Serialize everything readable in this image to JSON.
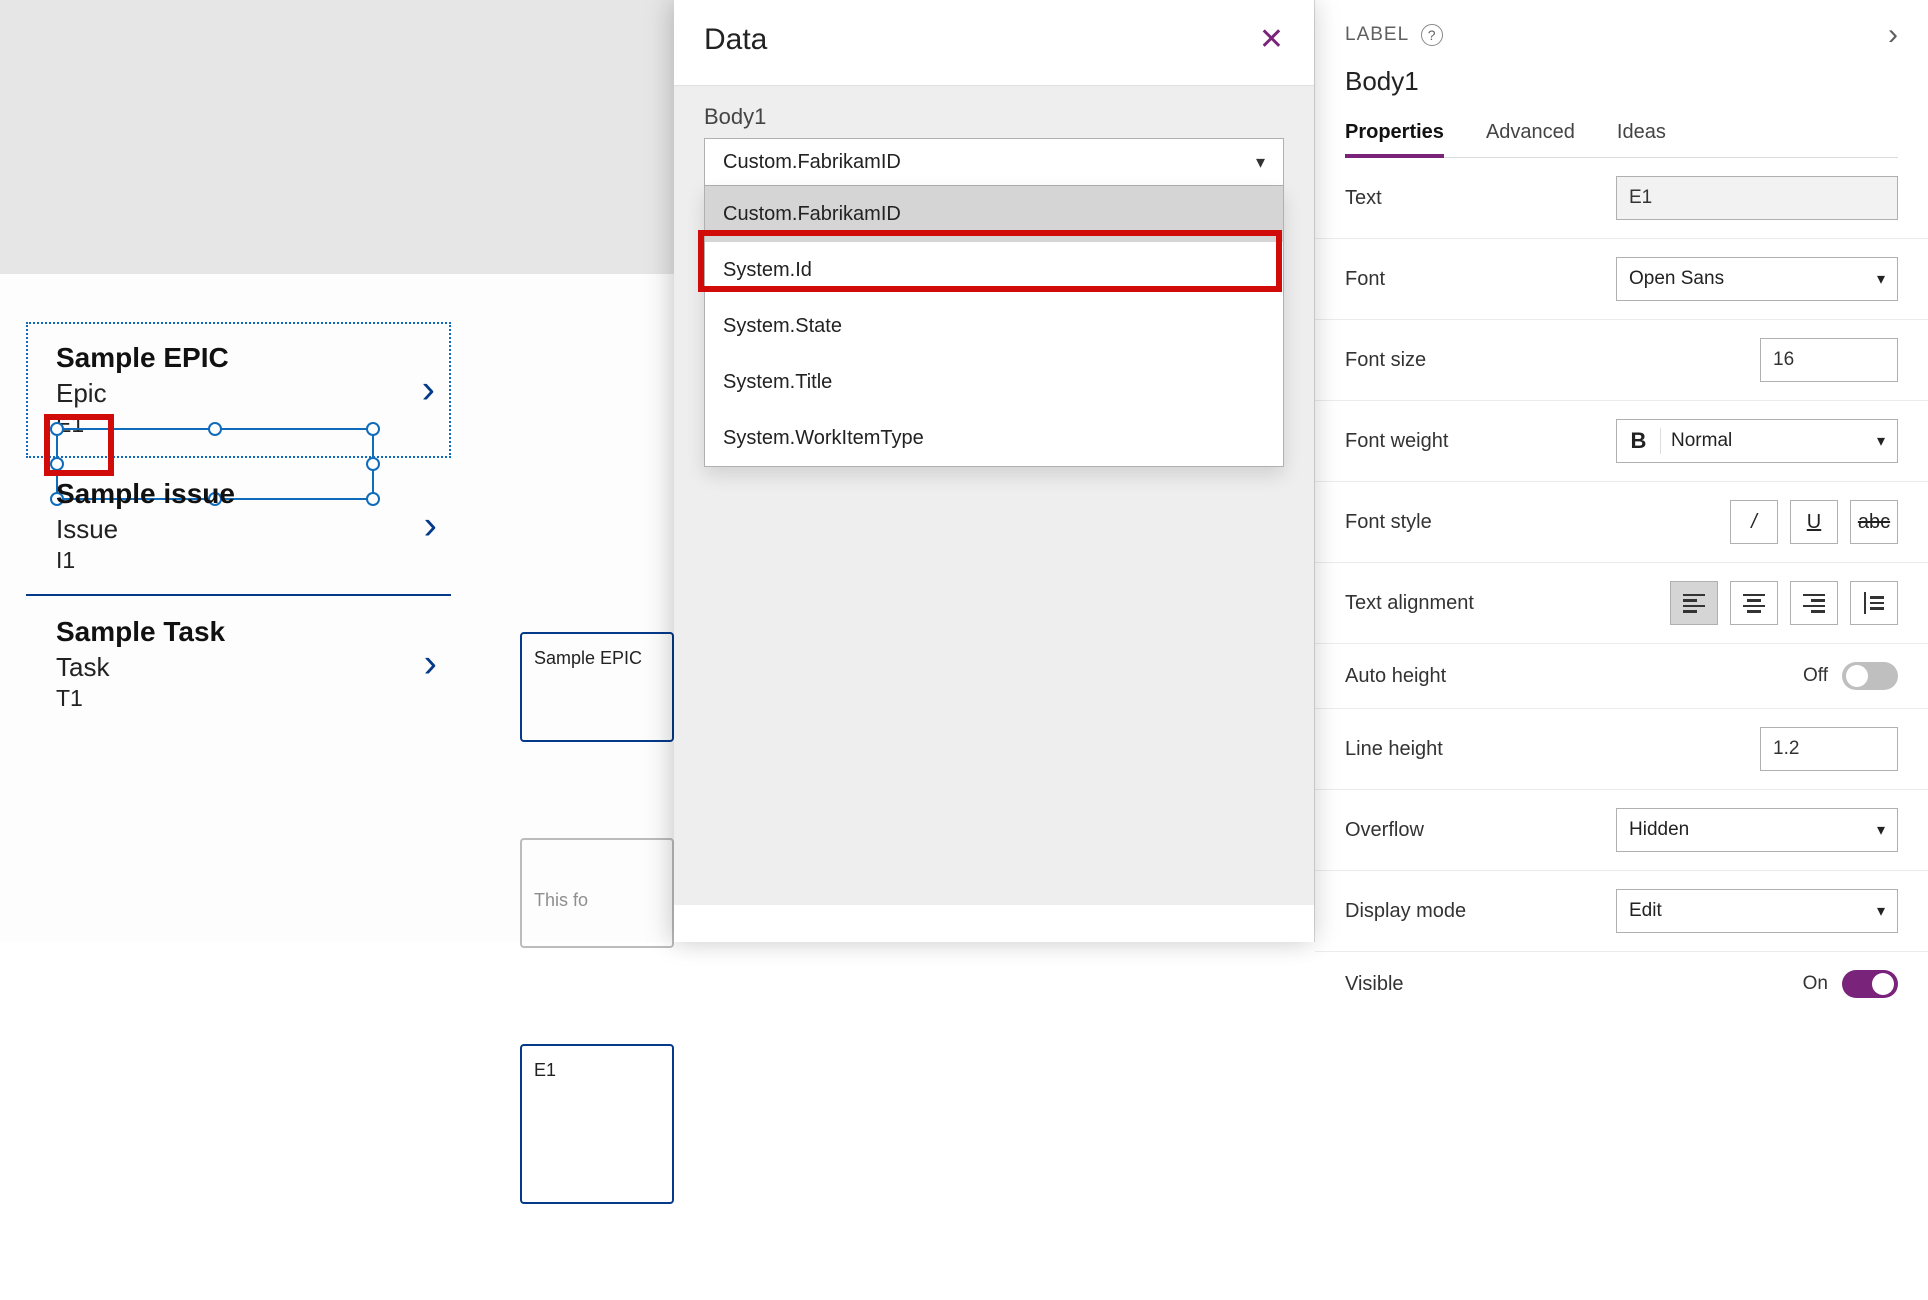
{
  "canvas": {
    "items": [
      {
        "title": "Sample EPIC",
        "subtitle": "Epic",
        "body": "E1"
      },
      {
        "title": "Sample issue",
        "subtitle": "Issue",
        "body": "I1"
      },
      {
        "title": "Sample Task",
        "subtitle": "Task",
        "body": "T1"
      }
    ],
    "preview_cards": {
      "card1": "Sample EPIC",
      "card2_placeholder": "This fo",
      "card3": "E1"
    }
  },
  "data_panel": {
    "title": "Data",
    "section_label": "Body1",
    "selected_value": "Custom.FabrikamID",
    "options": [
      "Custom.FabrikamID",
      "System.Id",
      "System.State",
      "System.Title",
      "System.WorkItemType"
    ]
  },
  "props_panel": {
    "type_label": "LABEL",
    "control_name": "Body1",
    "tabs": {
      "properties": "Properties",
      "advanced": "Advanced",
      "ideas": "Ideas"
    },
    "rows": {
      "text": {
        "label": "Text",
        "value": "E1"
      },
      "font": {
        "label": "Font",
        "value": "Open Sans"
      },
      "font_size": {
        "label": "Font size",
        "value": "16"
      },
      "font_weight": {
        "label": "Font weight",
        "value": "Normal",
        "bold_glyph": "B"
      },
      "font_style": {
        "label": "Font style"
      },
      "text_align": {
        "label": "Text alignment"
      },
      "auto_height": {
        "label": "Auto height",
        "state": "Off"
      },
      "line_height": {
        "label": "Line height",
        "value": "1.2"
      },
      "overflow": {
        "label": "Overflow",
        "value": "Hidden"
      },
      "display_mode": {
        "label": "Display mode",
        "value": "Edit"
      },
      "visible": {
        "label": "Visible",
        "state": "On"
      }
    },
    "style_glyphs": {
      "italic": "/",
      "underline": "U",
      "strike": "abc"
    }
  }
}
